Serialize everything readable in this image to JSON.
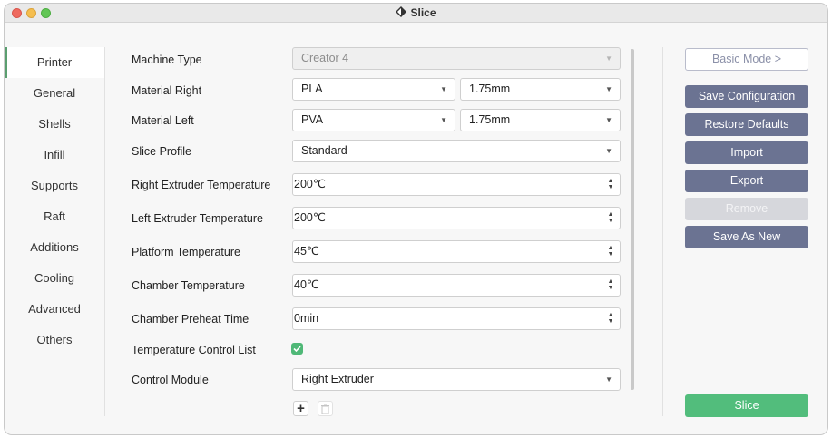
{
  "window": {
    "title": "Slice"
  },
  "sidebar": {
    "items": [
      {
        "label": "Printer",
        "active": true
      },
      {
        "label": "General"
      },
      {
        "label": "Shells"
      },
      {
        "label": "Infill"
      },
      {
        "label": "Supports"
      },
      {
        "label": "Raft"
      },
      {
        "label": "Additions"
      },
      {
        "label": "Cooling"
      },
      {
        "label": "Advanced"
      },
      {
        "label": "Others"
      }
    ]
  },
  "form": {
    "machine_type": {
      "label": "Machine Type",
      "value": "Creator 4"
    },
    "material_right": {
      "label": "Material Right",
      "material": "PLA",
      "diameter": "1.75mm"
    },
    "material_left": {
      "label": "Material Left",
      "material": "PVA",
      "diameter": "1.75mm"
    },
    "slice_profile": {
      "label": "Slice Profile",
      "value": "Standard"
    },
    "right_extruder_temp": {
      "label": "Right Extruder Temperature",
      "value": "200℃"
    },
    "left_extruder_temp": {
      "label": "Left Extruder Temperature",
      "value": "200℃"
    },
    "platform_temp": {
      "label": "Platform Temperature",
      "value": "45℃"
    },
    "chamber_temp": {
      "label": "Chamber Temperature",
      "value": "40℃"
    },
    "chamber_preheat_time": {
      "label": "Chamber Preheat Time",
      "value": "0min"
    },
    "temp_control_list": {
      "label": "Temperature Control List",
      "checked": true
    },
    "control_module": {
      "label": "Control Module",
      "value": "Right Extruder"
    }
  },
  "actions": {
    "basic_mode": "Basic Mode >",
    "save_configuration": "Save Configuration",
    "restore_defaults": "Restore Defaults",
    "import": "Import",
    "export": "Export",
    "remove": "Remove",
    "save_as_new": "Save As New",
    "slice": "Slice"
  },
  "colors": {
    "primary_button": "#6b7392",
    "slice_button": "#52bd7c",
    "checkbox": "#4fb877",
    "disabled_button": "#d6d7dc"
  }
}
